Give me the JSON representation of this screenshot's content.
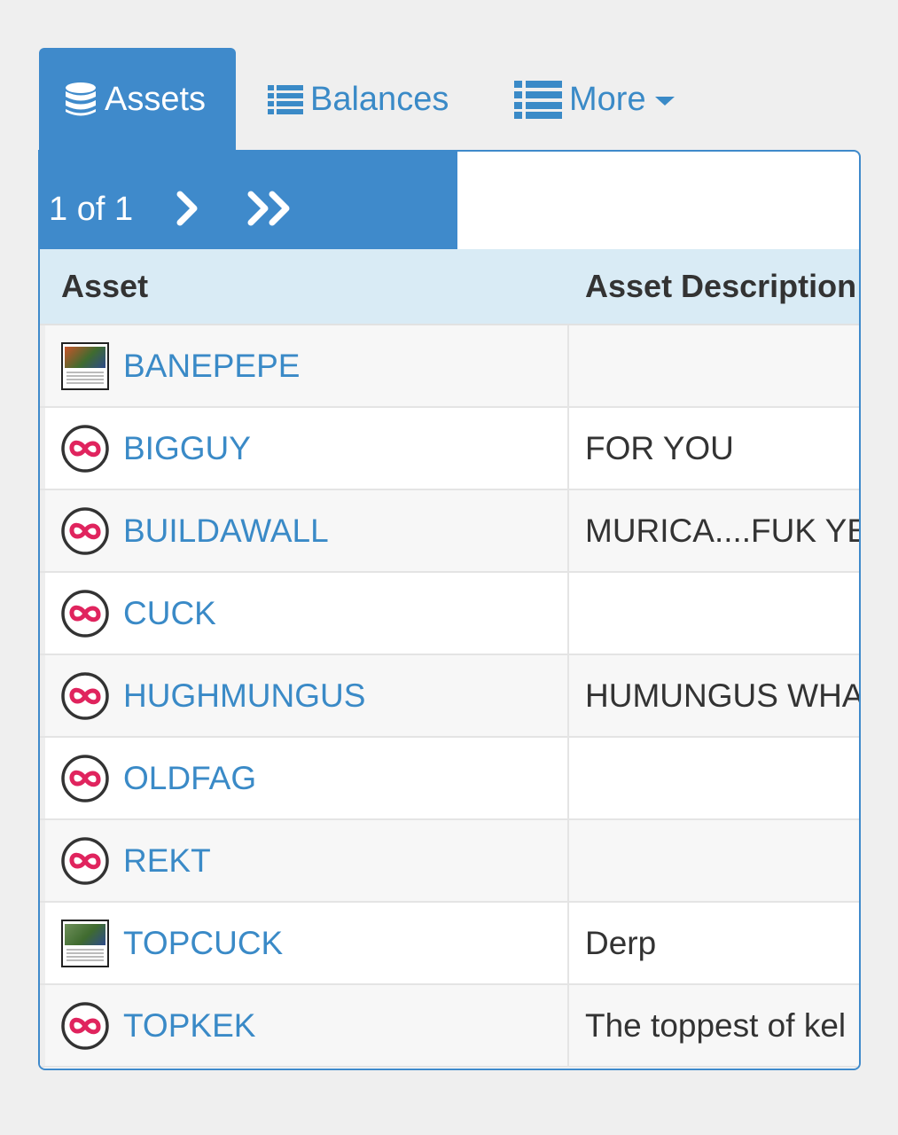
{
  "tabs": [
    {
      "label": "Assets",
      "icon": "database-icon",
      "active": true
    },
    {
      "label": "Balances",
      "icon": "list-icon",
      "active": false
    },
    {
      "label": "More",
      "icon": "list-icon",
      "active": false
    }
  ],
  "pager": {
    "count_text": "1 of 1"
  },
  "table": {
    "columns": [
      "Asset",
      "Asset Description"
    ],
    "rows": [
      {
        "asset": "BANEPEPE",
        "description": "",
        "icon": "pepe-card-thumbnail"
      },
      {
        "asset": "BIGGUY",
        "description": "FOR YOU",
        "icon": "counterparty-logo-icon"
      },
      {
        "asset": "BUILDAWALL",
        "description": "MURICA....FUK YE",
        "icon": "counterparty-logo-icon"
      },
      {
        "asset": "CUCK",
        "description": "",
        "icon": "counterparty-logo-icon"
      },
      {
        "asset": "HUGHMUNGUS",
        "description": "HUMUNGUS WHA",
        "icon": "counterparty-logo-icon"
      },
      {
        "asset": "OLDFAG",
        "description": "",
        "icon": "counterparty-logo-icon"
      },
      {
        "asset": "REKT",
        "description": "",
        "icon": "counterparty-logo-icon"
      },
      {
        "asset": "TOPCUCK",
        "description": "Derp",
        "icon": "pepe-card-thumbnail"
      },
      {
        "asset": "TOPKEK",
        "description": "The toppest of kel",
        "icon": "counterparty-logo-icon"
      }
    ]
  },
  "colors": {
    "primary": "#3f8acb",
    "link": "#3a8ac7",
    "header_bg": "#d9ebf5",
    "logo_red": "#e0245e"
  }
}
